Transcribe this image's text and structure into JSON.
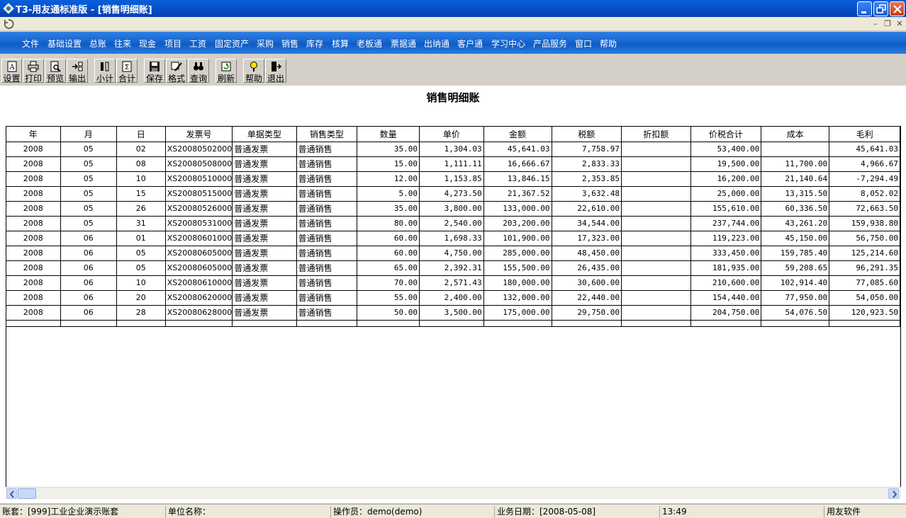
{
  "window": {
    "title": "T3-用友通标准版 - [销售明细账]"
  },
  "menu": [
    "文件",
    "基础设置",
    "总账",
    "往来",
    "现金",
    "项目",
    "工资",
    "固定资产",
    "采购",
    "销售",
    "库存",
    "核算",
    "老板通",
    "票据通",
    "出纳通",
    "客户通",
    "学习中心",
    "产品服务",
    "窗口",
    "帮助"
  ],
  "toolbar": {
    "setup": "设置",
    "print": "打印",
    "preview": "预览",
    "export": "输出",
    "subtotal": "小计",
    "total": "合计",
    "save": "保存",
    "format": "格式",
    "query": "查询",
    "refresh": "刷新",
    "help": "帮助",
    "exit": "退出"
  },
  "report": {
    "title": "销售明细账",
    "columns": [
      "年",
      "月",
      "日",
      "发票号",
      "单据类型",
      "销售类型",
      "数量",
      "单价",
      "金额",
      "税额",
      "折扣额",
      "价税合计",
      "成本",
      "毛利"
    ],
    "rows": [
      [
        "2008",
        "05",
        "02",
        "XS20080502000",
        "普通发票",
        "普通销售",
        "35.00",
        "1,304.03",
        "45,641.03",
        "7,758.97",
        "",
        "53,400.00",
        "",
        "45,641.03"
      ],
      [
        "2008",
        "05",
        "08",
        "XS20080508000",
        "普通发票",
        "普通销售",
        "15.00",
        "1,111.11",
        "16,666.67",
        "2,833.33",
        "",
        "19,500.00",
        "11,700.00",
        "4,966.67"
      ],
      [
        "2008",
        "05",
        "10",
        "XS20080510000",
        "普通发票",
        "普通销售",
        "12.00",
        "1,153.85",
        "13,846.15",
        "2,353.85",
        "",
        "16,200.00",
        "21,140.64",
        "-7,294.49"
      ],
      [
        "2008",
        "05",
        "15",
        "XS20080515000",
        "普通发票",
        "普通销售",
        "5.00",
        "4,273.50",
        "21,367.52",
        "3,632.48",
        "",
        "25,000.00",
        "13,315.50",
        "8,052.02"
      ],
      [
        "2008",
        "05",
        "26",
        "XS20080526000",
        "普通发票",
        "普通销售",
        "35.00",
        "3,800.00",
        "133,000.00",
        "22,610.00",
        "",
        "155,610.00",
        "60,336.50",
        "72,663.50"
      ],
      [
        "2008",
        "05",
        "31",
        "XS20080531000",
        "普通发票",
        "普通销售",
        "80.00",
        "2,540.00",
        "203,200.00",
        "34,544.00",
        "",
        "237,744.00",
        "43,261.20",
        "159,938.80"
      ],
      [
        "2008",
        "06",
        "01",
        "XS20080601000",
        "普通发票",
        "普通销售",
        "60.00",
        "1,698.33",
        "101,900.00",
        "17,323.00",
        "",
        "119,223.00",
        "45,150.00",
        "56,750.00"
      ],
      [
        "2008",
        "06",
        "05",
        "XS20080605000",
        "普通发票",
        "普通销售",
        "60.00",
        "4,750.00",
        "285,000.00",
        "48,450.00",
        "",
        "333,450.00",
        "159,785.40",
        "125,214.60"
      ],
      [
        "2008",
        "06",
        "05",
        "XS20080605000",
        "普通发票",
        "普通销售",
        "65.00",
        "2,392.31",
        "155,500.00",
        "26,435.00",
        "",
        "181,935.00",
        "59,208.65",
        "96,291.35"
      ],
      [
        "2008",
        "06",
        "10",
        "XS20080610000",
        "普通发票",
        "普通销售",
        "70.00",
        "2,571.43",
        "180,000.00",
        "30,600.00",
        "",
        "210,600.00",
        "102,914.40",
        "77,085.60"
      ],
      [
        "2008",
        "06",
        "20",
        "XS20080620000",
        "普通发票",
        "普通销售",
        "55.00",
        "2,400.00",
        "132,000.00",
        "22,440.00",
        "",
        "154,440.00",
        "77,950.00",
        "54,050.00"
      ],
      [
        "2008",
        "06",
        "28",
        "XS20080628000",
        "普通发票",
        "普通销售",
        "50.00",
        "3,500.00",
        "175,000.00",
        "29,750.00",
        "",
        "204,750.00",
        "54,076.50",
        "120,923.50"
      ]
    ]
  },
  "status": {
    "account": "账套：[999]工业企业演示账套",
    "unit": "单位名称：",
    "operator": "操作员：demo(demo)",
    "date": "业务日期：[2008-05-08]",
    "time": "13:49",
    "vendor": "用友软件"
  }
}
